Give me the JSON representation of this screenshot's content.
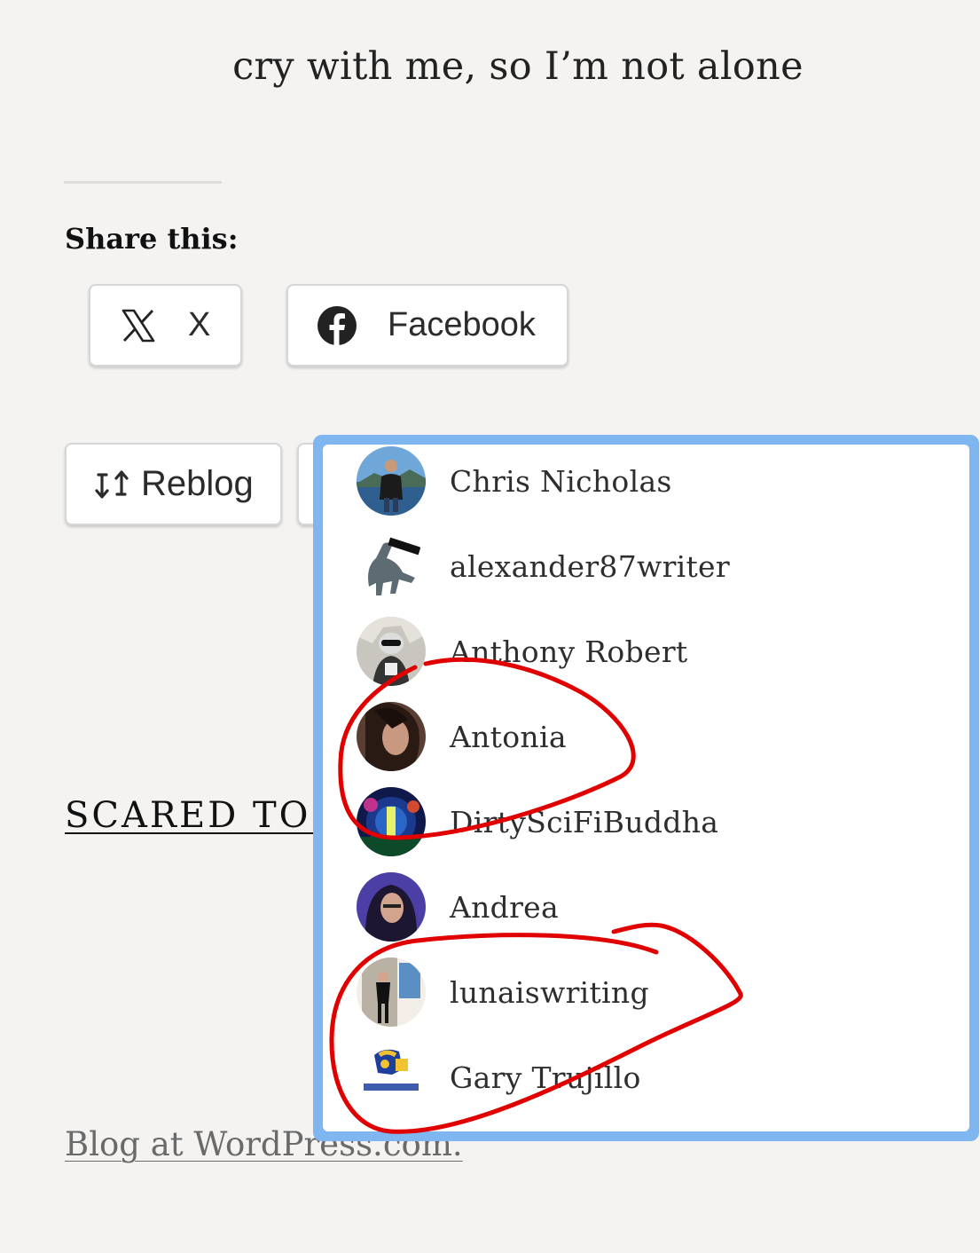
{
  "post": {
    "last_line": "cry with me, so I’m not alone"
  },
  "share": {
    "heading": "Share this:",
    "x_label": "X",
    "facebook_label": "Facebook"
  },
  "actions": {
    "reblog_label": "Reblog"
  },
  "next_post": {
    "title_visible": "SCARED TO BE"
  },
  "footer": {
    "link": "Blog at WordPress.com."
  },
  "likers": [
    {
      "name": "Chris Nicholas"
    },
    {
      "name": "alexander87writer"
    },
    {
      "name": "Anthony Robert"
    },
    {
      "name": "Antonia"
    },
    {
      "name": "DirtySciFiBuddha"
    },
    {
      "name": "Andrea"
    },
    {
      "name": "lunaiswriting"
    },
    {
      "name": "Gary Trujillo"
    }
  ],
  "colors": {
    "page_bg": "#f4f3f1",
    "popup_border": "#7fb6ef",
    "annotation_red": "#e00000"
  }
}
